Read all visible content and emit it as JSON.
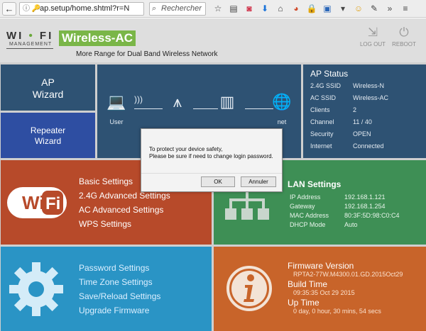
{
  "browser": {
    "back_glyph": "←",
    "url": "ap.setup/home.shtml?r=N",
    "url_icons": "ⓘ 🔑",
    "search_placeholder": "Rechercher",
    "toolbar_icons": [
      "star-icon",
      "clipboard-icon",
      "pocket-icon",
      "download-icon",
      "home-icon",
      "extension-icon",
      "lock-icon",
      "screenshot-icon",
      "smiley-icon",
      "translate-icon",
      "overflow-icon",
      "menu-icon"
    ]
  },
  "header": {
    "logo_text": "WI • FI",
    "logo_sub": "MANAGEMENT",
    "product": "Wireless-AC",
    "tagline": "More Range for Dual Band Wireless Network",
    "logout_label": "LOG OUT",
    "reboot_label": "REBOOT"
  },
  "tiles": {
    "ap_wizard": [
      "AP",
      "Wizard"
    ],
    "repeater_wizard": [
      "Repeater",
      "Wizard"
    ],
    "network": {
      "user_label": "User",
      "internet_label_visible": "net"
    },
    "ap_status": {
      "title": "AP Status",
      "rows": [
        {
          "k": "2.4G SSID",
          "v": "Wireless-N"
        },
        {
          "k": "AC SSID",
          "v": "Wireless-AC"
        },
        {
          "k": "Clients",
          "v": "2"
        },
        {
          "k": "Channel",
          "v": "11 / 40"
        },
        {
          "k": "Security",
          "v": "OPEN"
        },
        {
          "k": "Internet",
          "v": "Connected"
        }
      ]
    },
    "wifi_menu": [
      "Basic Settings",
      "2.4G Advanced Settings",
      "AC Advanced Settings",
      "WPS Settings"
    ],
    "lan": {
      "title": "LAN Settings",
      "rows": [
        {
          "k": "IP Address",
          "v": "192.168.1.121"
        },
        {
          "k": "Gateway",
          "v": "192.168.1.254"
        },
        {
          "k": "MAC Address",
          "v": "80:3F:5D:98:C0:C4"
        },
        {
          "k": "DHCP Mode",
          "v": "Auto"
        }
      ]
    },
    "system_menu": [
      "Password Settings",
      "Time Zone Settings",
      "Save/Reload Settings",
      "Upgrade Firmware"
    ],
    "firmware": {
      "fw_title": "Firmware Version",
      "fw_value": "RPTA2-77W.M4300.01.GD.2015Oct29",
      "build_title": "Build Time",
      "build_value": "09:35:35 Oct 29 2015",
      "uptime_title": "Up Time",
      "uptime_value": "0 day, 0 hour, 30 mins, 54 secs"
    }
  },
  "dialog": {
    "line1": "To protect your device safety,",
    "line2": "Please be sure if need to change login password.",
    "ok": "OK",
    "cancel": "Annuler"
  },
  "colors": {
    "tile_dark_blue": "#2e5273",
    "tile_blue": "#2e4ea2",
    "tile_red": "#b74a2a",
    "tile_green": "#3e8f55",
    "tile_cyan": "#2a94c5",
    "tile_orange": "#c8642a",
    "brand_green": "#7ab648"
  }
}
